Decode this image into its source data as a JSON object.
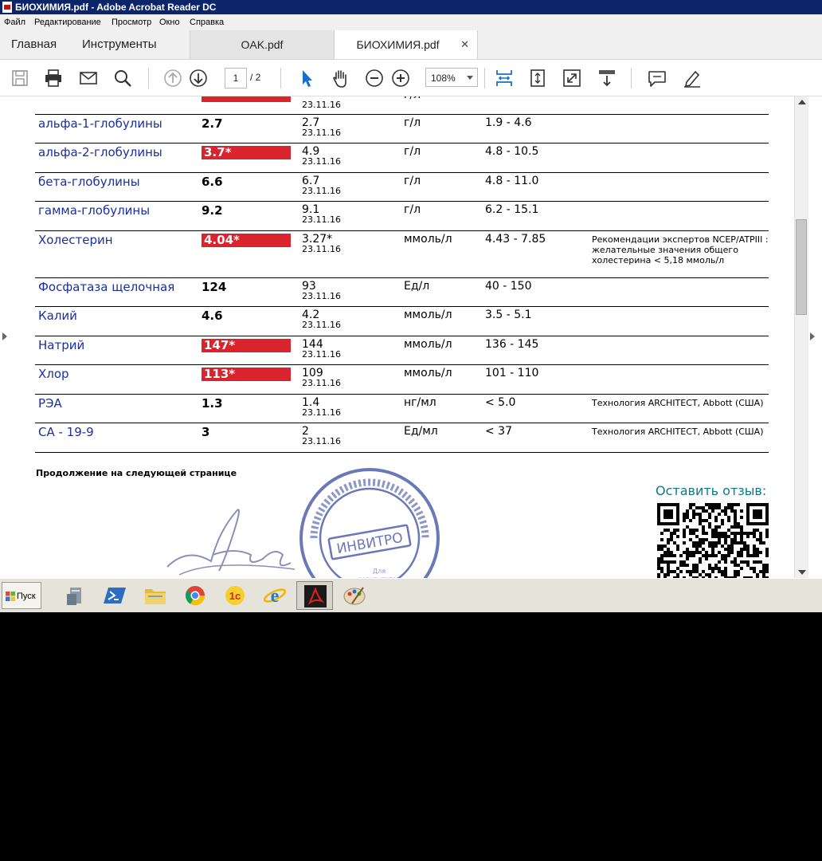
{
  "window": {
    "title": "БИОХИМИЯ.pdf - Adobe Acrobat Reader DC"
  },
  "menu": [
    "Файл",
    "Редактирование",
    "Просмотр",
    "Окно",
    "Справка"
  ],
  "tabs": {
    "home": "Главная",
    "tools": "Инструменты",
    "doc1": "OAK.pdf",
    "doc2": "БИОХИМИЯ.pdf"
  },
  "toolbar": {
    "page_current": "1",
    "page_total": "/ 2",
    "zoom": "108%"
  },
  "results": [
    {
      "name": "альфа-1-глобулины",
      "value": "2.7",
      "flag": false,
      "prev": "2.7",
      "prev_date": "23.11.16",
      "unit": "г/л",
      "ref": "1.9 - 4.6",
      "comment": ""
    },
    {
      "name": "альфа-2-глобулины",
      "value": "3.7*",
      "flag": true,
      "prev": "4.9",
      "prev_date": "23.11.16",
      "unit": "г/л",
      "ref": "4.8 - 10.5",
      "comment": ""
    },
    {
      "name": "бета-глобулины",
      "value": "6.6",
      "flag": false,
      "prev": "6.7",
      "prev_date": "23.11.16",
      "unit": "г/л",
      "ref": "4.8 - 11.0",
      "comment": ""
    },
    {
      "name": "гамма-глобулины",
      "value": "9.2",
      "flag": false,
      "prev": "9.1",
      "prev_date": "23.11.16",
      "unit": "г/л",
      "ref": "6.2 - 15.1",
      "comment": ""
    },
    {
      "name": "Холестерин",
      "value": "4.04*",
      "flag": true,
      "prev": "3.27*",
      "prev_date": "23.11.16",
      "unit": "ммоль/л",
      "ref": "4.43 - 7.85",
      "comment": "Рекомендации экспертов NCEP/ATPIII : желательные значения общего холестерина < 5,18 ммоль/л"
    },
    {
      "name": "Фосфатаза щелочная",
      "value": "124",
      "flag": false,
      "prev": "93",
      "prev_date": "23.11.16",
      "unit": "Ед/л",
      "ref": "40 - 150",
      "comment": ""
    },
    {
      "name": "Калий",
      "value": "4.6",
      "flag": false,
      "prev": "4.2",
      "prev_date": "23.11.16",
      "unit": "ммоль/л",
      "ref": "3.5 - 5.1",
      "comment": ""
    },
    {
      "name": "Натрий",
      "value": "147*",
      "flag": true,
      "prev": "144",
      "prev_date": "23.11.16",
      "unit": "ммоль/л",
      "ref": "136 - 145",
      "comment": ""
    },
    {
      "name": "Хлор",
      "value": "113*",
      "flag": true,
      "prev": "109",
      "prev_date": "23.11.16",
      "unit": "ммоль/л",
      "ref": "101 - 110",
      "comment": ""
    },
    {
      "name": "РЭА",
      "value": "1.3",
      "flag": false,
      "prev": "1.4",
      "prev_date": "23.11.16",
      "unit": "нг/мл",
      "ref": "< 5.0",
      "comment": "Технология ARCHITECT, Abbott (США)"
    },
    {
      "name": "CA - 19-9",
      "value": "3",
      "flag": false,
      "prev": "2",
      "prev_date": "23.11.16",
      "unit": "Ед/мл",
      "ref": "< 37",
      "comment": "Технология ARCHITECT, Abbott (США)"
    }
  ],
  "partial_top_row": {
    "prev_date": "23.11.16",
    "unit": "г/л"
  },
  "footer": {
    "continued": "Продолжение на следующей странице",
    "review": "Оставить отзыв:"
  },
  "stamp": {
    "center": "ИНВИТРО"
  },
  "taskbar": {
    "start": "Пуск"
  },
  "colors": {
    "flag_red": "#d9232d",
    "name_blue": "#1a2fa0",
    "titlebar": "#0b246a",
    "review_teal": "#0a7a8a"
  }
}
